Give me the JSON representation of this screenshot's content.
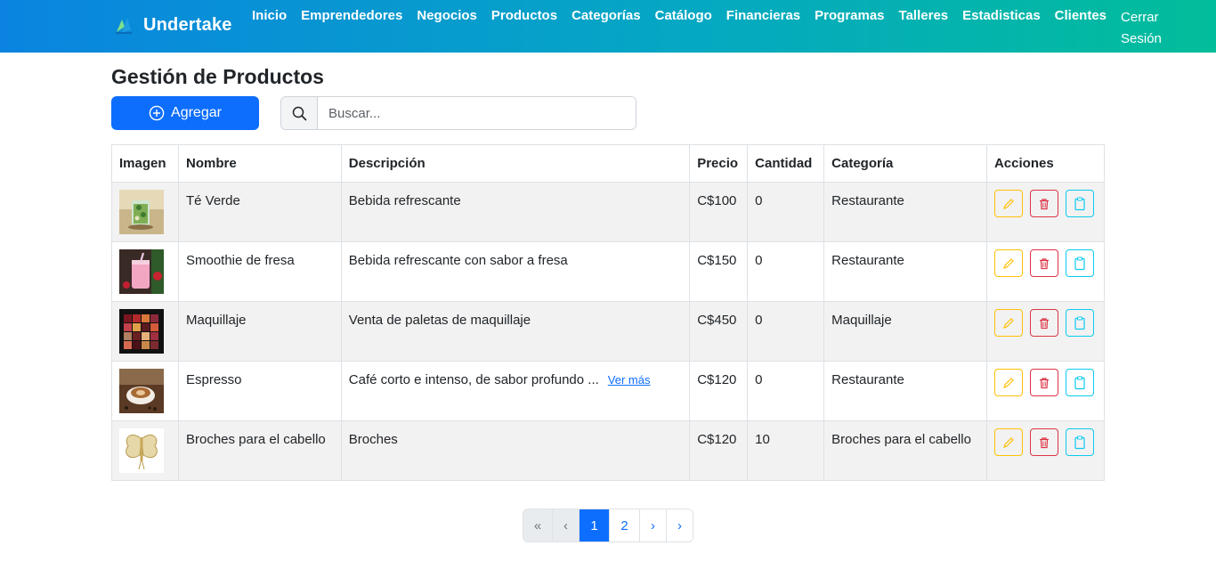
{
  "nav": {
    "brand": "Undertake",
    "links": [
      "Inicio",
      "Emprendedores",
      "Negocios",
      "Productos",
      "Categorías",
      "Catálogo",
      "Financieras",
      "Programas",
      "Talleres",
      "Estadisticas",
      "Clientes"
    ],
    "logout_line1": "Cerrar",
    "logout_line2": "Sesión"
  },
  "page": {
    "title": "Gestión de Productos",
    "add_label": "Agregar",
    "search_placeholder": "Buscar..."
  },
  "table": {
    "headers": {
      "image": "Imagen",
      "name": "Nombre",
      "description": "Descripción",
      "price": "Precio",
      "quantity": "Cantidad",
      "category": "Categoría",
      "actions": "Acciones"
    },
    "rows": [
      {
        "name": "Té Verde",
        "description": "Bebida refrescante",
        "more": "",
        "price": "C$100",
        "quantity": "0",
        "category": "Restaurante"
      },
      {
        "name": "Smoothie de fresa",
        "description": "Bebida refrescante con sabor a fresa",
        "more": "",
        "price": "C$150",
        "quantity": "0",
        "category": "Restaurante"
      },
      {
        "name": "Maquillaje",
        "description": "Venta de paletas de maquillaje",
        "more": "",
        "price": "C$450",
        "quantity": "0",
        "category": "Maquillaje"
      },
      {
        "name": "Espresso",
        "description": "Café corto e intenso, de sabor profundo ...",
        "more": "Ver más",
        "price": "C$120",
        "quantity": "0",
        "category": "Restaurante"
      },
      {
        "name": "Broches para el cabello",
        "description": "Broches",
        "more": "",
        "price": "C$120",
        "quantity": "10",
        "category": "Broches para el cabello"
      }
    ]
  },
  "pagination": {
    "first": "«",
    "prev": "‹",
    "pages": [
      "1",
      "2"
    ],
    "next": "›",
    "last": "›"
  },
  "colors": {
    "primary": "#0d6efd",
    "edit": "#ffc107",
    "delete": "#dc3545",
    "copy": "#0dcaf0"
  }
}
